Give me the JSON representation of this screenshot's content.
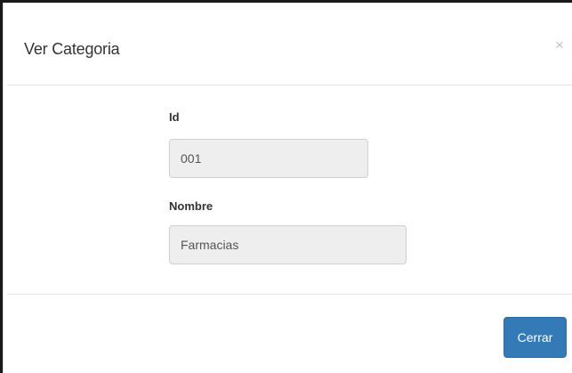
{
  "modal": {
    "title": "Ver Categoria",
    "close_icon_glyph": "×",
    "fields": {
      "id_label": "Id",
      "id_value": "001",
      "nombre_label": "Nombre",
      "nombre_value": "Farmacias"
    },
    "footer": {
      "close_label": "Cerrar"
    }
  },
  "colors": {
    "primary_button": "#337ab7",
    "input_background": "#eeeeee"
  }
}
